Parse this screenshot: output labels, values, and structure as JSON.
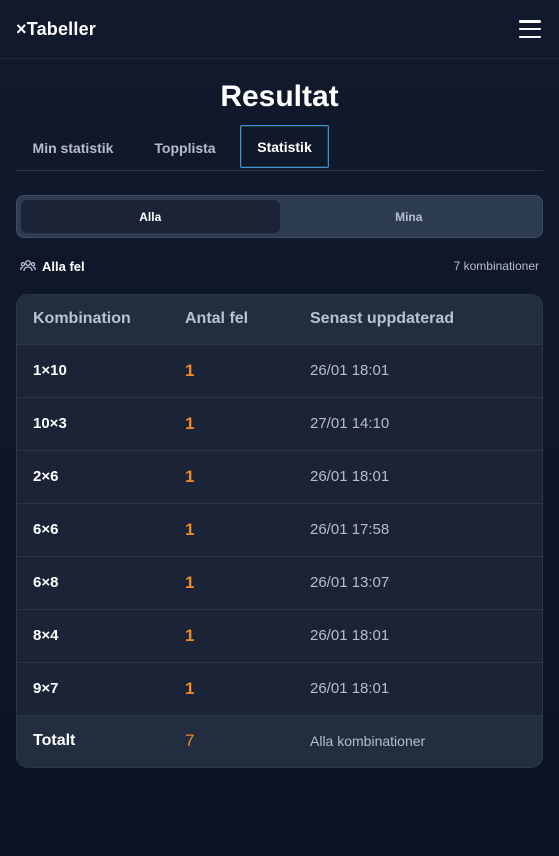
{
  "header": {
    "brand": "×Tabeller",
    "menu_icon": "hamburger-menu-icon"
  },
  "page": {
    "title": "Resultat"
  },
  "tabs": [
    {
      "label": "Min statistik",
      "active": false
    },
    {
      "label": "Topplista",
      "active": false
    },
    {
      "label": "Statistik",
      "active": true
    }
  ],
  "toggle": {
    "options": [
      {
        "label": "Alla",
        "active": true
      },
      {
        "label": "Mina",
        "active": false
      }
    ]
  },
  "filter": {
    "icon": "users-icon",
    "label": "Alla fel",
    "count": "7 kombinationer"
  },
  "table": {
    "columns": [
      "Kombination",
      "Antal fel",
      "Senast uppdaterad"
    ],
    "rows": [
      {
        "combination": "1×10",
        "errors": "1",
        "updated": "26/01 18:01"
      },
      {
        "combination": "10×3",
        "errors": "1",
        "updated": "27/01 14:10"
      },
      {
        "combination": "2×6",
        "errors": "1",
        "updated": "26/01 18:01"
      },
      {
        "combination": "6×6",
        "errors": "1",
        "updated": "26/01 17:58"
      },
      {
        "combination": "6×8",
        "errors": "1",
        "updated": "26/01 13:07"
      },
      {
        "combination": "8×4",
        "errors": "1",
        "updated": "26/01 18:01"
      },
      {
        "combination": "9×7",
        "errors": "1",
        "updated": "26/01 18:01"
      }
    ],
    "total": {
      "label": "Totalt",
      "errors": "7",
      "note": "Alla kombinationer"
    }
  },
  "colors": {
    "background": "#0f1729",
    "accent_orange": "#ef8a2a",
    "active_tab_border": "#3d8fe0"
  }
}
